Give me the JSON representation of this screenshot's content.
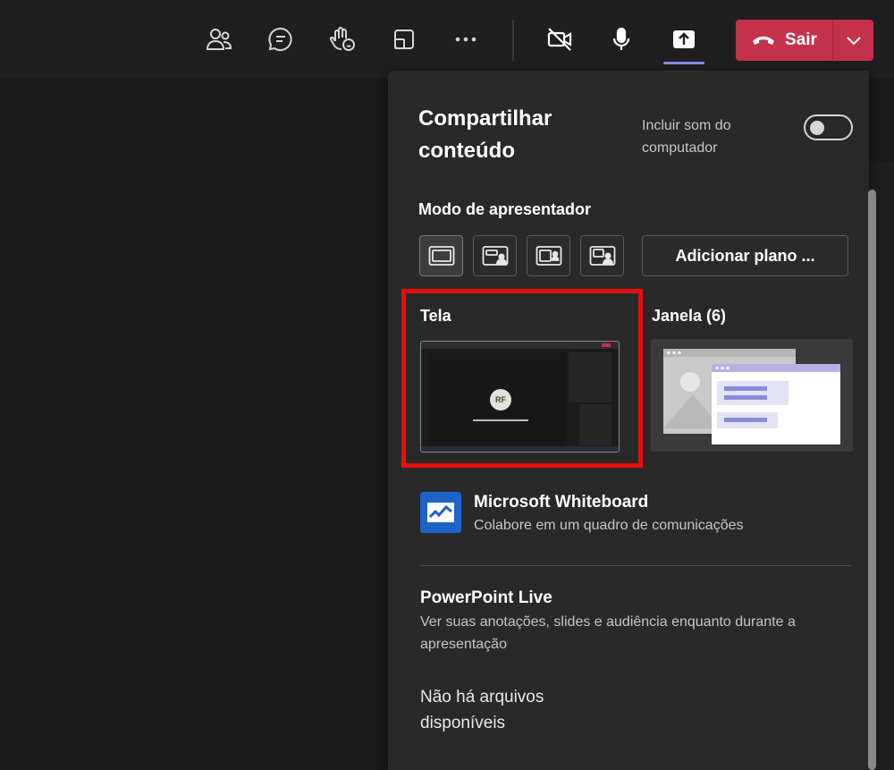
{
  "toolbar": {
    "icons": [
      "people-icon",
      "chat-icon",
      "raise-hand-icon",
      "view-icon",
      "more-icon",
      "camera-off-icon",
      "mic-icon",
      "share-icon"
    ],
    "leave_label": "Sair"
  },
  "share_panel": {
    "title": "Compartilhar conteúdo",
    "include_sound": "Incluir som do computador",
    "include_sound_on": false,
    "presenter_mode_label": "Modo de apresentador",
    "add_background_label": "Adicionar plano ...",
    "screen_label": "Tela",
    "window_label": "Janela (6)",
    "screen_thumb_initials": "RF",
    "whiteboard": {
      "title": "Microsoft Whiteboard",
      "subtitle": "Colabore em um quadro de comunicações"
    },
    "powerpoint": {
      "title": "PowerPoint Live",
      "subtitle": "Ver suas anotações, slides e audiência enquanto durante a apresentação"
    },
    "no_files": "Não há arquivos disponíveis"
  },
  "colors": {
    "leave": "#c4314b",
    "highlight": "#e60f0f",
    "accent": "#8d8ef0"
  }
}
